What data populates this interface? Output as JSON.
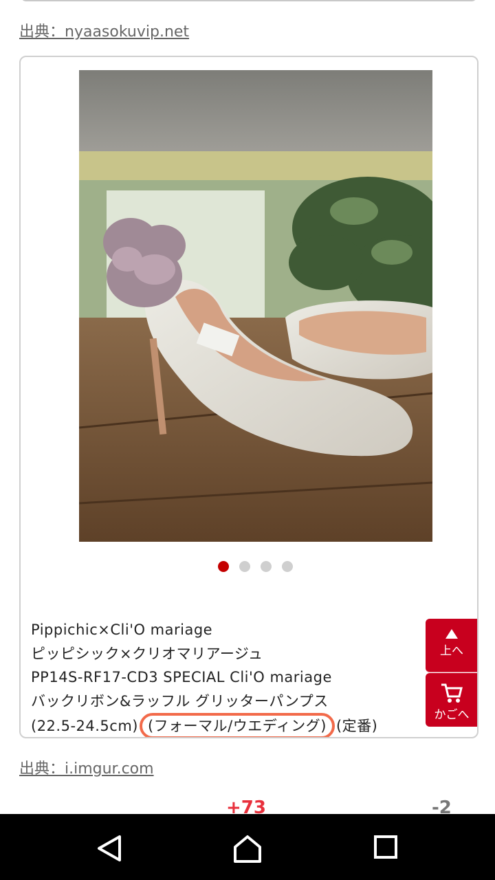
{
  "sources": {
    "top": "出典：nyaasokuvip.net",
    "bottom": "出典：i.imgur.com"
  },
  "product": {
    "line1": "Pippichic×Cli'O mariage",
    "line2": "ピッピシック×クリオマリアージュ",
    "line3": "PP14S-RF17-CD3 SPECIAL Cli'O mariage",
    "line4": "バックリボン&ラッフル グリッターパンプス",
    "line5_prefix": "(22.5-24.5cm)",
    "line5_highlight": "(フォーマル/ウエディング)",
    "line5_suffix": "(定番)"
  },
  "carousel": {
    "total": 4,
    "active_index": 0
  },
  "float_buttons": {
    "up_label": "上へ",
    "cart_label": "かごへ"
  },
  "votes": {
    "plus": "+73",
    "minus": "-2"
  },
  "colors": {
    "accent_red": "#c8001e",
    "highlight_circle": "#f26a4a",
    "dot_active": "#c40000"
  },
  "icons": {
    "up": "triangle-up-icon",
    "cart": "cart-icon",
    "back": "back-triangle-icon",
    "home": "home-icon",
    "recents": "square-icon"
  }
}
